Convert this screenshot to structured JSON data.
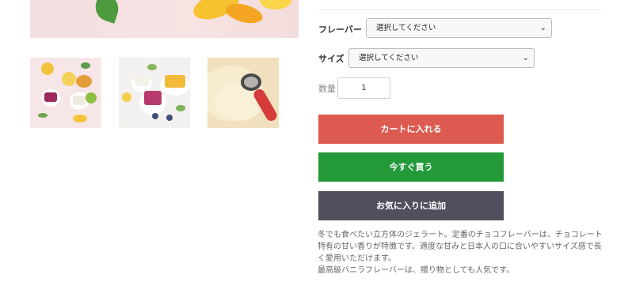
{
  "product": {
    "flavor": {
      "label": "フレーバー",
      "selected": "選択してください"
    },
    "size": {
      "label": "サイズ",
      "selected": "選択してください"
    },
    "quantity": {
      "label": "数量",
      "value": "1"
    },
    "buttons": {
      "add_to_cart": "カートに入れる",
      "buy_now": "今すぐ買う",
      "add_to_favorites": "お気に入りに追加"
    },
    "description": [
      "冬でも食べたい立方体のジェラート。定番のチョコフレーバーは、チョコレート特有の甘い香りが特徴です。適度な甘みと日本人の口に合いやすいサイズ感で長く愛用いただけます。",
      "最高級バニラフレーバーは、贈り物としても人気です。"
    ]
  },
  "colors": {
    "cart_button": "#dc5a4f",
    "buy_button": "#23993a",
    "favorite_button": "#524e5e"
  },
  "icons": [
    "chevron-down-icon"
  ]
}
